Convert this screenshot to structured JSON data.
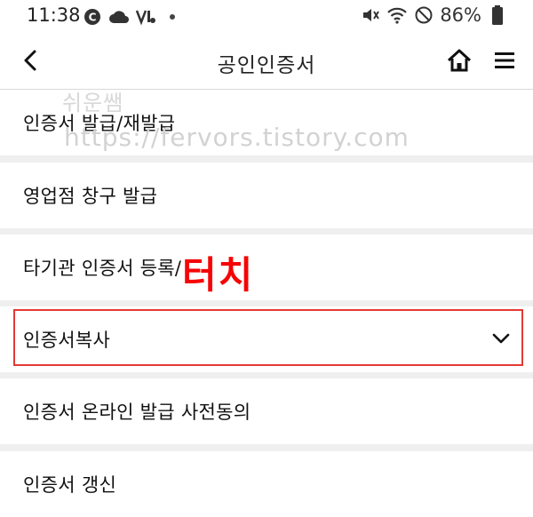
{
  "status_bar": {
    "time": "11:38",
    "battery": "86%",
    "left_icons": [
      "c-circle-icon",
      "cloud-icon",
      "volte-icon",
      "dot-icon"
    ],
    "right_icons": [
      "mute-icon",
      "wifi-icon",
      "do-not-disturb-icon",
      "battery-icon"
    ]
  },
  "app_bar": {
    "title": "공인인증서",
    "back_icon": "chevron-left-icon",
    "home_icon": "home-icon",
    "menu_icon": "hamburger-menu-icon"
  },
  "menu": {
    "items": [
      {
        "label": "인증서 발급/재발급"
      },
      {
        "label": "영업점 창구 발급"
      },
      {
        "label": "타기관 인증서 등록/"
      },
      {
        "label": "인증서복사",
        "expanded": false,
        "highlighted": true
      },
      {
        "label": "인증서 온라인 발급 사전동의"
      },
      {
        "label": "인증서 갱신"
      }
    ]
  },
  "annotation": {
    "text": "터치",
    "color": "#f50505",
    "box_color": "#e53935"
  },
  "watermark": {
    "name": "쉬운쌤",
    "url": "https://fervors.tistory.com"
  },
  "colors": {
    "background": "#efefef",
    "item_background": "#ffffff",
    "text": "#111111"
  }
}
